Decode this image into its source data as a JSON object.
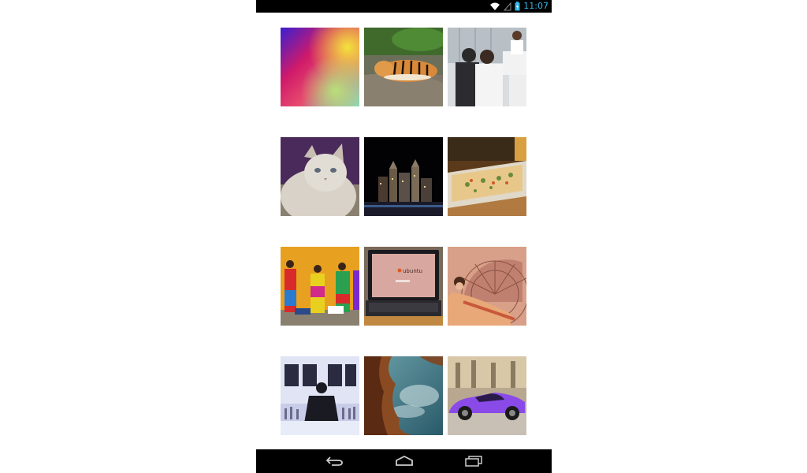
{
  "status_bar": {
    "time": "11:07",
    "icons": [
      "wifi-icon",
      "signal-icon",
      "battery-icon"
    ],
    "accent_color": "#33b5e5"
  },
  "gallery": {
    "columns": 3,
    "rows": 4,
    "items": [
      {
        "subject": "abstract-color-blur"
      },
      {
        "subject": "tiger-lying-on-rock"
      },
      {
        "subject": "men-at-office-counter"
      },
      {
        "subject": "white-persian-cat"
      },
      {
        "subject": "city-skyline-at-night"
      },
      {
        "subject": "pizza-on-tray"
      },
      {
        "subject": "women-in-colorful-dresses"
      },
      {
        "subject": "ubuntu-laptop",
        "text": "ubuntu"
      },
      {
        "subject": "woman-with-fan-vintage-art"
      },
      {
        "subject": "bartender-at-bar"
      },
      {
        "subject": "rocky-coast-seascape"
      },
      {
        "subject": "purple-sports-car"
      }
    ]
  },
  "nav_bar": {
    "buttons": [
      "back-icon",
      "home-icon",
      "recent-apps-icon"
    ]
  }
}
